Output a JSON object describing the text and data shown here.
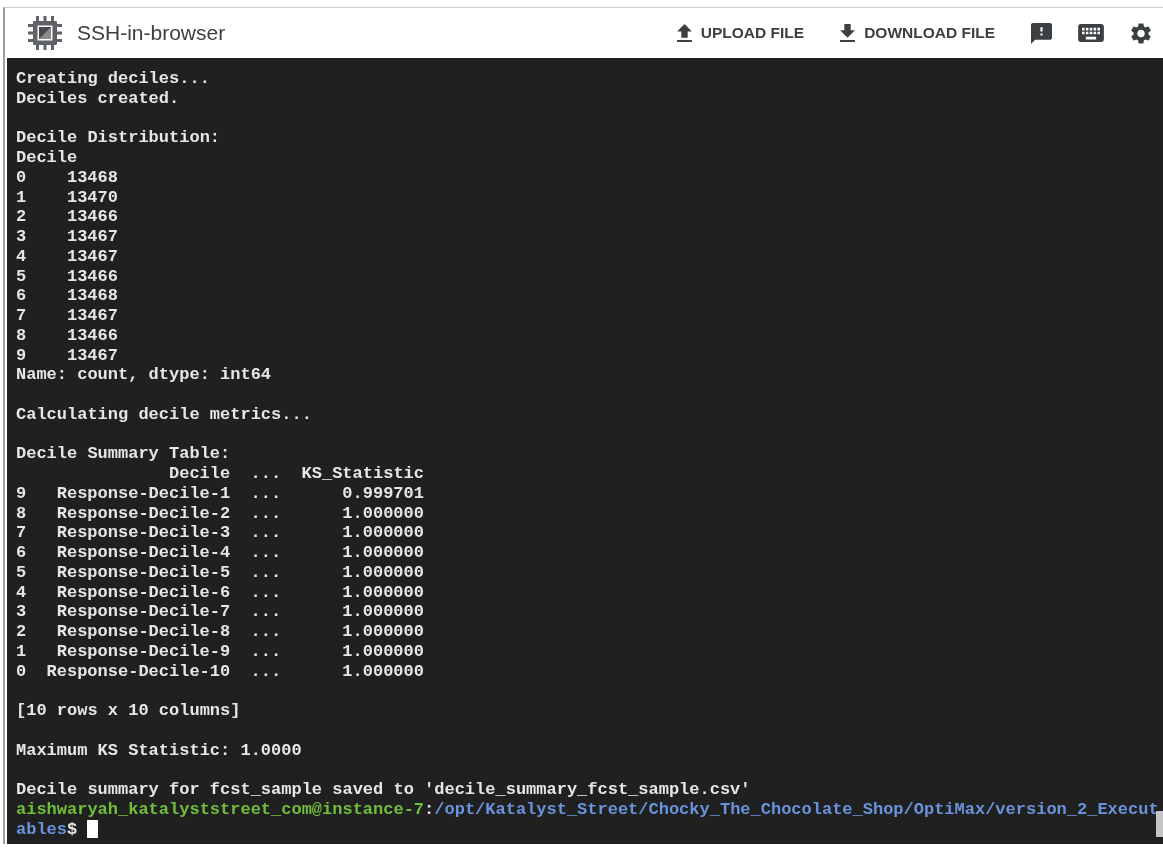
{
  "window": {
    "title": "SSH-in-browser"
  },
  "toolbar": {
    "actions": [
      {
        "kind": "upload",
        "label": "UPLOAD FILE"
      },
      {
        "kind": "download",
        "label": "DOWNLOAD FILE"
      }
    ],
    "icon_buttons": [
      {
        "kind": "feedback"
      },
      {
        "kind": "keyboard"
      },
      {
        "kind": "settings"
      }
    ]
  },
  "terminal": {
    "output": [
      {
        "kind": "text",
        "lines": [
          "Creating deciles...",
          "Deciles created."
        ]
      },
      {
        "kind": "series",
        "title": "Decile Distribution:",
        "index_name": "Decile",
        "rows": [
          {
            "index": "0",
            "value": "13468"
          },
          {
            "index": "1",
            "value": "13470"
          },
          {
            "index": "2",
            "value": "13466"
          },
          {
            "index": "3",
            "value": "13467"
          },
          {
            "index": "4",
            "value": "13467"
          },
          {
            "index": "5",
            "value": "13466"
          },
          {
            "index": "6",
            "value": "13468"
          },
          {
            "index": "7",
            "value": "13467"
          },
          {
            "index": "8",
            "value": "13466"
          },
          {
            "index": "9",
            "value": "13467"
          }
        ],
        "footer": "Name: count, dtype: int64"
      },
      {
        "kind": "text",
        "lines": [
          "Calculating decile metrics..."
        ]
      },
      {
        "kind": "table",
        "title": "Decile Summary Table:",
        "columns": [
          "Decile",
          "...",
          "KS_Statistic"
        ],
        "rows": [
          {
            "index": "9",
            "cells": [
              "Response-Decile-1",
              "...",
              "0.999701"
            ]
          },
          {
            "index": "8",
            "cells": [
              "Response-Decile-2",
              "...",
              "1.000000"
            ]
          },
          {
            "index": "7",
            "cells": [
              "Response-Decile-3",
              "...",
              "1.000000"
            ]
          },
          {
            "index": "6",
            "cells": [
              "Response-Decile-4",
              "...",
              "1.000000"
            ]
          },
          {
            "index": "5",
            "cells": [
              "Response-Decile-5",
              "...",
              "1.000000"
            ]
          },
          {
            "index": "4",
            "cells": [
              "Response-Decile-6",
              "...",
              "1.000000"
            ]
          },
          {
            "index": "3",
            "cells": [
              "Response-Decile-7",
              "...",
              "1.000000"
            ]
          },
          {
            "index": "2",
            "cells": [
              "Response-Decile-8",
              "...",
              "1.000000"
            ]
          },
          {
            "index": "1",
            "cells": [
              "Response-Decile-9",
              "...",
              "1.000000"
            ]
          },
          {
            "index": "0",
            "cells": [
              "Response-Decile-10",
              "...",
              "1.000000"
            ]
          }
        ]
      },
      {
        "kind": "text",
        "lines": [
          "[10 rows x 10 columns]"
        ]
      },
      {
        "kind": "text",
        "lines": [
          "Maximum KS Statistic: 1.0000"
        ]
      },
      {
        "kind": "text",
        "lines": [
          "Decile summary for fcst_sample saved to 'decile_summary_fcst_sample.csv'"
        ]
      }
    ],
    "prompt": {
      "user_host": "aishwaryah_katalyststreet_com@instance-7",
      "separator": ":",
      "path_lines": [
        "/opt/Katalyst_Street/Chocky_The_Chocolate_Shop/OptiMax/version_2_Execut",
        "ables"
      ],
      "symbol": "$"
    }
  }
}
